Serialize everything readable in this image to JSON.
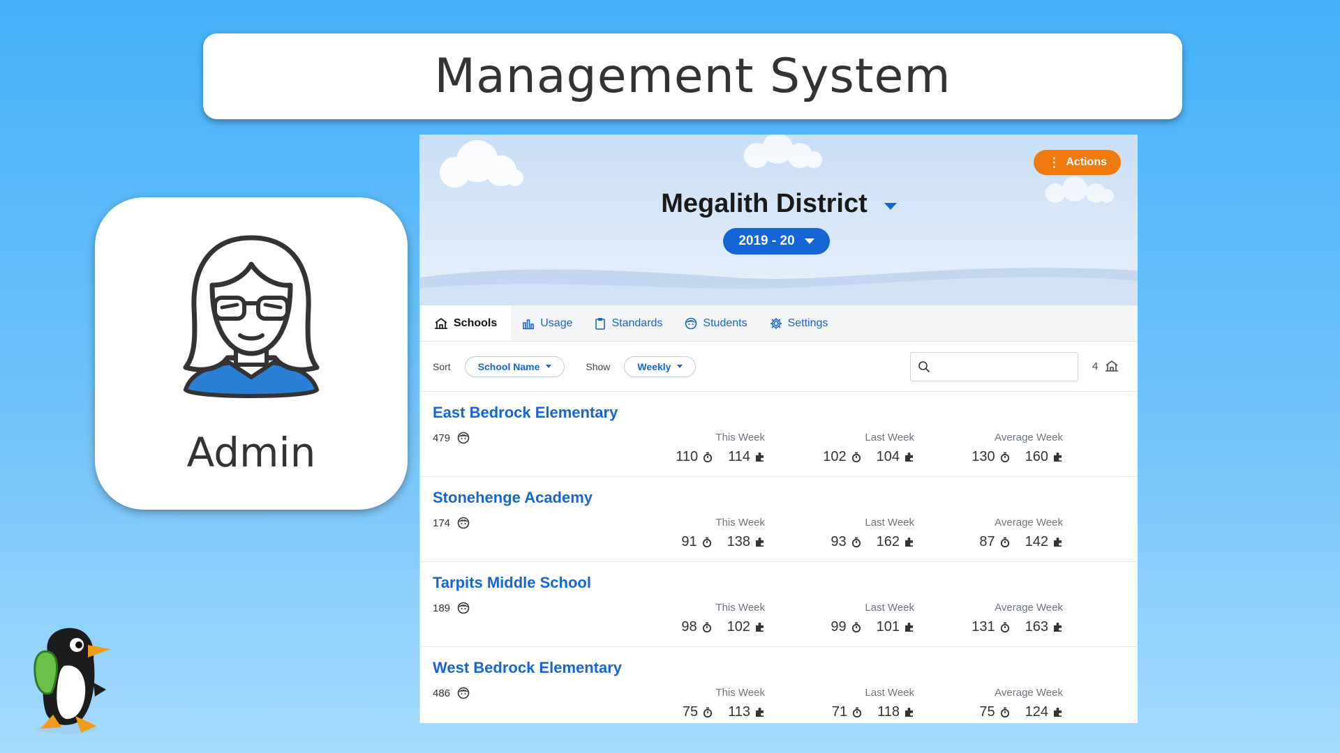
{
  "slide": {
    "title": "Management System",
    "role_label": "Admin"
  },
  "app": {
    "district_name": "Megalith District",
    "school_year": "2019 - 20",
    "actions_label": "Actions",
    "tabs": [
      {
        "label": "Schools",
        "icon": "school-icon",
        "active": true
      },
      {
        "label": "Usage",
        "icon": "bar-chart-icon",
        "active": false
      },
      {
        "label": "Standards",
        "icon": "clipboard-icon",
        "active": false
      },
      {
        "label": "Students",
        "icon": "student-face-icon",
        "active": false
      },
      {
        "label": "Settings",
        "icon": "gear-icon",
        "active": false
      }
    ],
    "toolbar": {
      "sort_label": "Sort",
      "sort_value": "School Name",
      "show_label": "Show",
      "show_value": "Weekly",
      "search_placeholder": "",
      "school_count": "4"
    },
    "stat_headers": [
      "This Week",
      "Last Week",
      "Average Week"
    ],
    "schools": [
      {
        "name": "East Bedrock Elementary",
        "students": "479",
        "this_week": [
          "110",
          "114"
        ],
        "last_week": [
          "102",
          "104"
        ],
        "average_week": [
          "130",
          "160"
        ]
      },
      {
        "name": "Stonehenge Academy",
        "students": "174",
        "this_week": [
          "91",
          "138"
        ],
        "last_week": [
          "93",
          "162"
        ],
        "average_week": [
          "87",
          "142"
        ]
      },
      {
        "name": "Tarpits Middle School",
        "students": "189",
        "this_week": [
          "98",
          "102"
        ],
        "last_week": [
          "99",
          "101"
        ],
        "average_week": [
          "131",
          "163"
        ]
      },
      {
        "name": "West Bedrock Elementary",
        "students": "486",
        "this_week": [
          "75",
          "113"
        ],
        "last_week": [
          "71",
          "118"
        ],
        "average_week": [
          "75",
          "124"
        ]
      }
    ]
  },
  "colors": {
    "accent_blue": "#1565d8",
    "actions_orange": "#f07a0f",
    "background_blue": "#44b0f9"
  }
}
